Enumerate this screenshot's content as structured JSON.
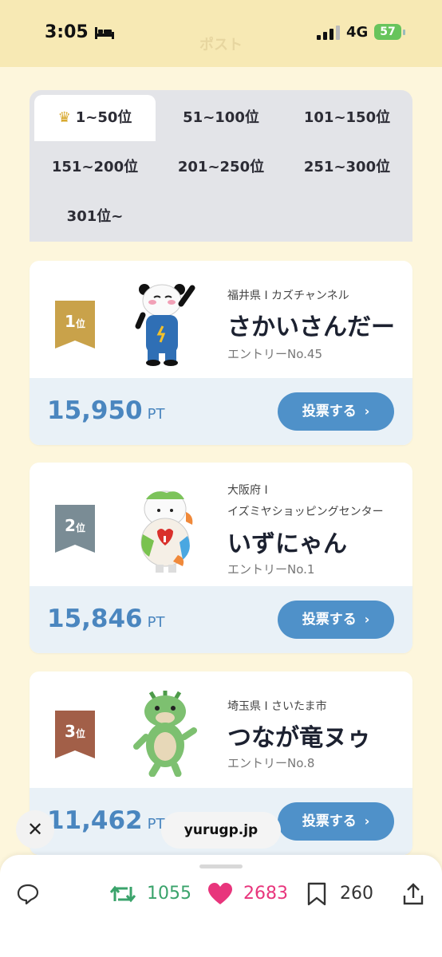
{
  "status": {
    "time": "3:05",
    "network": "4G",
    "battery": "57"
  },
  "background_title": "ポスト",
  "tabs": [
    {
      "label": "1~50位",
      "active": true
    },
    {
      "label": "51~100位"
    },
    {
      "label": "101~150位"
    },
    {
      "label": "151~200位"
    },
    {
      "label": "201~250位"
    },
    {
      "label": "251~300位"
    },
    {
      "label": "301位~"
    }
  ],
  "entries": [
    {
      "rank": "1",
      "rank_suffix": "位",
      "rank_color": "#c9a24a",
      "location": "福井県 I カズチャンネル",
      "name": "さかいさんだー",
      "entry": "エントリーNo.45",
      "points": "15,950",
      "unit": "PT",
      "vote_label": "投票する"
    },
    {
      "rank": "2",
      "rank_suffix": "位",
      "rank_color": "#7a8c95",
      "location_line1": "大阪府 I",
      "location_line2": "イズミヤショッピングセンター",
      "name": "いずにゃん",
      "entry": "エントリーNo.1",
      "points": "15,846",
      "unit": "PT",
      "vote_label": "投票する"
    },
    {
      "rank": "3",
      "rank_suffix": "位",
      "rank_color": "#a25f48",
      "location": "埼玉県 I さいたま市",
      "name": "つなが竜ヌゥ",
      "entry": "エントリーNo.8",
      "points": "11,462",
      "unit": "PT",
      "vote_label": "投票する"
    }
  ],
  "overlay": {
    "close": "✕",
    "url": "yurugp.jp"
  },
  "actions": {
    "reposts": "1055",
    "likes": "2683",
    "bookmarks": "260"
  },
  "colors": {
    "accent_blue": "#4f91c9",
    "repost_green": "#3aa36b",
    "like_pink": "#e8357c"
  }
}
